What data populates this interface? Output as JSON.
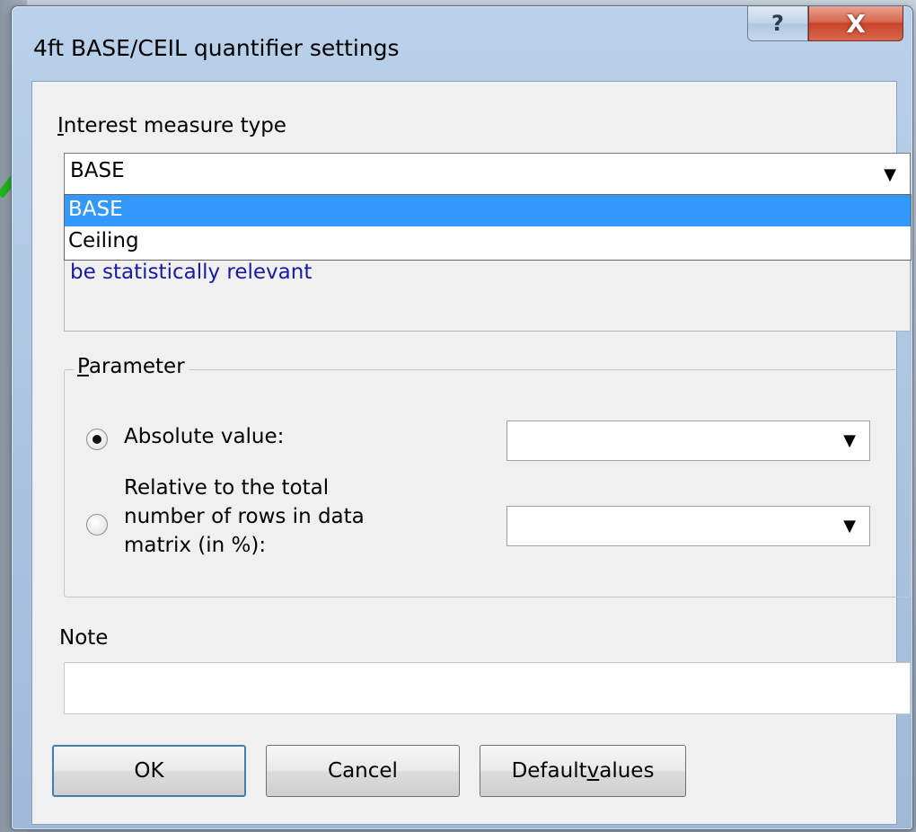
{
  "window": {
    "title": "4ft BASE/CEIL quantifier settings",
    "help_glyph": "?",
    "close_glyph": "X"
  },
  "interest": {
    "label_mnemonic": "I",
    "label_rest": "nterest measure type",
    "selected": "BASE",
    "options": [
      "BASE",
      "Ceiling"
    ],
    "description_visible": "be statistically relevant"
  },
  "parameter": {
    "legend_mnemonic": "P",
    "legend_rest": "arameter",
    "absolute_label": "Absolute value:",
    "absolute_value": "",
    "relative_label_line1": "Relative to the total",
    "relative_label_line2": "number of rows in data",
    "relative_label_line3": "matrix (in %):",
    "relative_value": "",
    "selected": "absolute"
  },
  "note": {
    "label": "Note",
    "value": ""
  },
  "buttons": {
    "ok": "OK",
    "cancel": "Cancel",
    "default_pre": "Default ",
    "default_mnemonic": "v",
    "default_post": "alues"
  },
  "icons": {
    "dropdown": "chevron-down-icon",
    "help": "help-icon",
    "close": "close-icon",
    "pointer": "arrow-pointer-icon"
  },
  "colors": {
    "selection": "#3399ff",
    "description_text": "#1a1aa0",
    "close_button": "#c8432a",
    "pointer_arrow": "#1fb51f"
  }
}
